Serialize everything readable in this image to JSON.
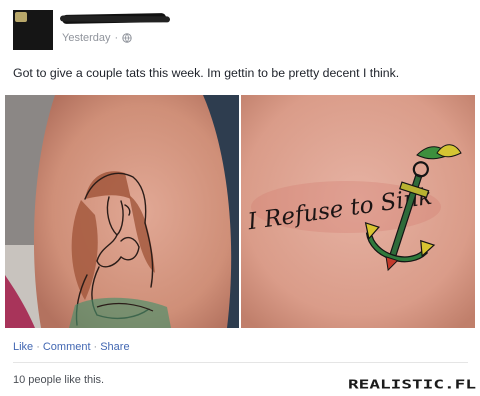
{
  "post": {
    "timestamp": "Yesterday",
    "text": "Got to give a couple tats this week. Im gettin to be pretty decent I think.",
    "tattoo_script": "I Refuse to Sink",
    "actions": {
      "like": "Like",
      "comment": "Comment",
      "share": "Share",
      "separator": "·"
    },
    "likes_summary": "10 people like this."
  },
  "watermark": {
    "text": "REALISTIC.FL"
  },
  "colors": {
    "link": "#4267b2",
    "meta": "#90949c",
    "skin": "#d99b84",
    "ink": "#1b1414"
  },
  "icons": {
    "audience": "globe-icon"
  }
}
